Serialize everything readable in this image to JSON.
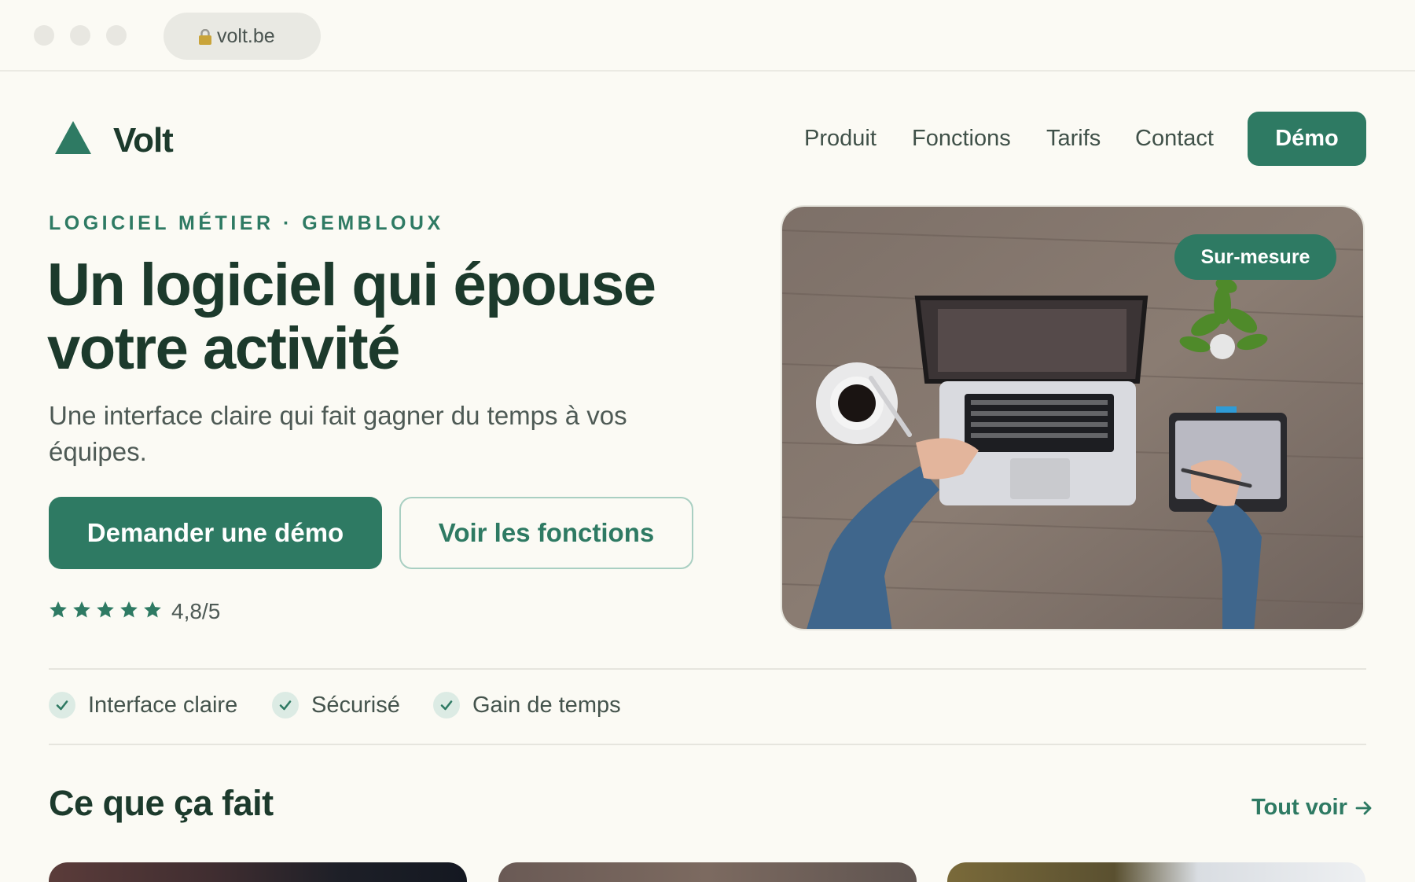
{
  "browser": {
    "url": "volt.be",
    "icons": {
      "lock": "lock-icon"
    }
  },
  "nav": {
    "brand": "Volt",
    "links": [
      "Produit",
      "Fonctions",
      "Tarifs",
      "Contact"
    ],
    "demo_label": "Démo"
  },
  "hero": {
    "eyebrow": "LOGICIEL MÉTIER · GEMBLOUX",
    "title_line1": "Un logiciel qui épouse",
    "title_line2": "votre activité",
    "subtitle": "Une interface claire qui fait gagner du temps à vos équipes.",
    "cta_primary": "Demander une démo",
    "cta_secondary": "Voir les fonctions",
    "rating": {
      "stars": 5,
      "value": "4,8/5"
    },
    "image_badge": "Sur-mesure"
  },
  "features": [
    "Interface claire",
    "Sécurisé",
    "Gain de temps"
  ],
  "section": {
    "title": "Ce que ça fait",
    "see_all": "Tout voir"
  },
  "colors": {
    "accent": "#2e7a63",
    "heading": "#1c3a2c",
    "background": "#fbfaf4"
  }
}
